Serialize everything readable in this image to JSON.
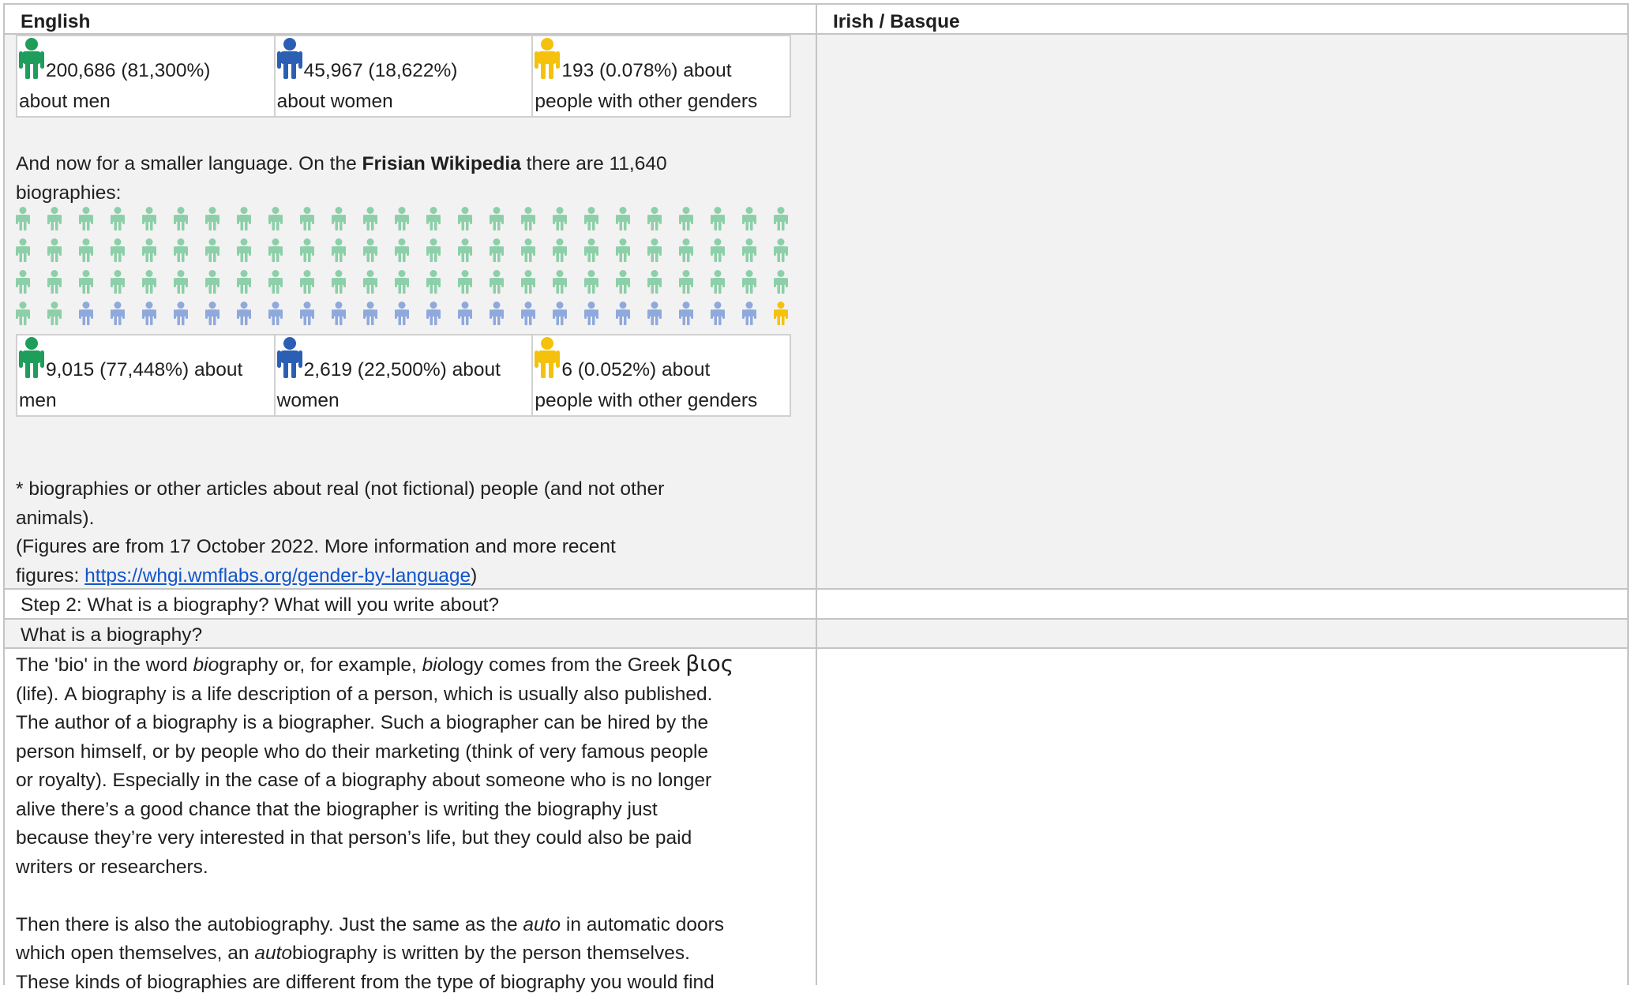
{
  "table": {
    "col_en_header": "English",
    "col_ga_header": "Irish / Basque"
  },
  "english_stats": {
    "men": "200,686 (81,300%)",
    "men_suffix": "about men",
    "women": "45,967 (18,622%)",
    "women_suffix": "about women",
    "other": "193 (0.078%) about",
    "other_suffix": "people with other genders"
  },
  "frisian": {
    "intro_pre": "And now for a smaller language. On the ",
    "intro_bold": "Frisian Wikipedia",
    "intro_post": " there are 11,640",
    "intro_line2": "biographies:",
    "people_rows": [
      [
        "m",
        "m",
        "m",
        "m",
        "m",
        "m",
        "m",
        "m",
        "m",
        "m",
        "m",
        "m",
        "m",
        "m",
        "m",
        "m",
        "m",
        "m",
        "m",
        "m",
        "m",
        "m",
        "m",
        "m",
        "m"
      ],
      [
        "m",
        "m",
        "m",
        "m",
        "m",
        "m",
        "m",
        "m",
        "m",
        "m",
        "m",
        "m",
        "m",
        "m",
        "m",
        "m",
        "m",
        "m",
        "m",
        "m",
        "m",
        "m",
        "m",
        "m",
        "m"
      ],
      [
        "m",
        "m",
        "m",
        "m",
        "m",
        "m",
        "m",
        "m",
        "m",
        "m",
        "m",
        "m",
        "m",
        "m",
        "m",
        "m",
        "m",
        "m",
        "m",
        "m",
        "m",
        "m",
        "m",
        "m",
        "m"
      ],
      [
        "m",
        "m",
        "w",
        "w",
        "w",
        "w",
        "w",
        "w",
        "w",
        "w",
        "w",
        "w",
        "w",
        "w",
        "w",
        "w",
        "w",
        "w",
        "w",
        "w",
        "w",
        "w",
        "w",
        "w",
        "o"
      ]
    ],
    "men": "9,015 (77,448%) about",
    "men_suffix": "men",
    "women": "2,619 (22,500%) about",
    "women_suffix": "women",
    "other": "6 (0.052%) about",
    "other_suffix": "people with other genders"
  },
  "footnote": {
    "line1": "* biographies or other articles about real (not fictional) people (and not other",
    "line2": "animals).",
    "line3": "(Figures are from 17 October 2022. More information and more recent",
    "line4_pre": "figures: ",
    "link": "https://whgi.wmflabs.org/gender-by-language",
    "line4_post": ")"
  },
  "step2": {
    "title": "Step 2: What is a biography? What will you write about?",
    "subtitle": "What is a biography?"
  },
  "bio_text": {
    "p1": [
      {
        "pre": "The 'bio' in the word ",
        "em": "bio",
        "post": "graphy or, for example, ",
        "em2": "bio",
        "post2": "logy comes from the Greek ",
        "greek": "βιος"
      },
      "(life). A biography is a life description of a person, which is usually also published.",
      "The author of a biography is a biographer. Such a biographer can be hired by the",
      "person himself, or by people who do their marketing (think of very famous people",
      "or royalty). Especially in the case of a biography about someone who is no longer",
      "alive there’s a good chance that the biographer is writing the biography just",
      "because they’re very interested in that person’s life, but they could also be paid",
      "writers or researchers."
    ],
    "p2_line1_pre": "Then there is also the autobiography. Just the same as the ",
    "p2_line1_em": "auto",
    "p2_line1_post": " in automatic doors",
    "p2_line2_pre": "which open themselves, an ",
    "p2_line2_em": "auto",
    "p2_line2_post": "biography is written by the person themselves.",
    "p2_line3": "These kinds of biographies are different from the type of biography you would find"
  },
  "colors": {
    "men": "#1e9e5a",
    "women": "#2b5fb4",
    "other": "#f4c20d",
    "men_light": "#8ccfa8",
    "women_light": "#8fa9dc",
    "other_light": "#f4c20d"
  }
}
